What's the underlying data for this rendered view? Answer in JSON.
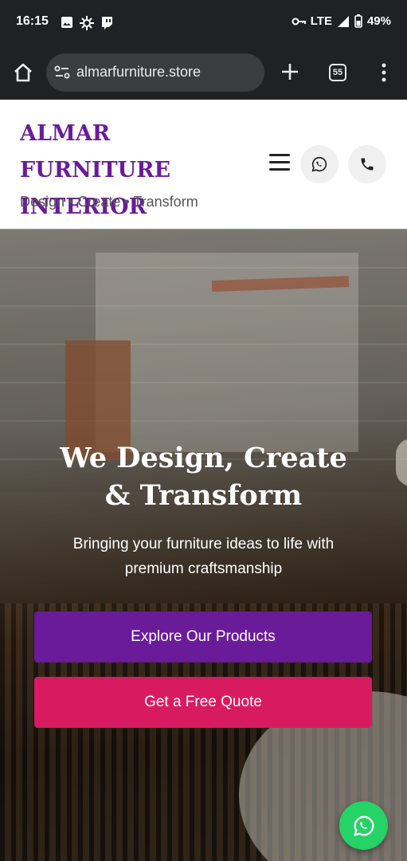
{
  "status_bar": {
    "time": "16:15",
    "network": "LTE",
    "battery": "49%",
    "icons": [
      "image-icon",
      "settings-icon",
      "twitch-icon",
      "vpn-key-icon",
      "signal-icon",
      "battery-icon"
    ]
  },
  "browser": {
    "url": "almarfurniture.store",
    "tab_count": "55",
    "icons": [
      "home-icon",
      "site-settings-icon",
      "plus-icon",
      "tabs-icon",
      "more-vert-icon"
    ]
  },
  "header": {
    "brand": "ALMAR FURNITURE INTERIOR",
    "tagline": "Design • Create • Transform",
    "icons": [
      "hamburger-icon",
      "whatsapp-icon",
      "phone-icon"
    ]
  },
  "hero": {
    "title": "We Design, Create & Transform",
    "subtitle": "Bringing your furniture ideas to life with premium craftsmanship",
    "primary_button": "Explore Our Products",
    "secondary_button": "Get a Free Quote"
  },
  "colors": {
    "brand_purple": "#6a1b9a",
    "accent_pink": "#d81b60",
    "whatsapp_green": "#25d366",
    "browser_chrome": "#202124"
  }
}
